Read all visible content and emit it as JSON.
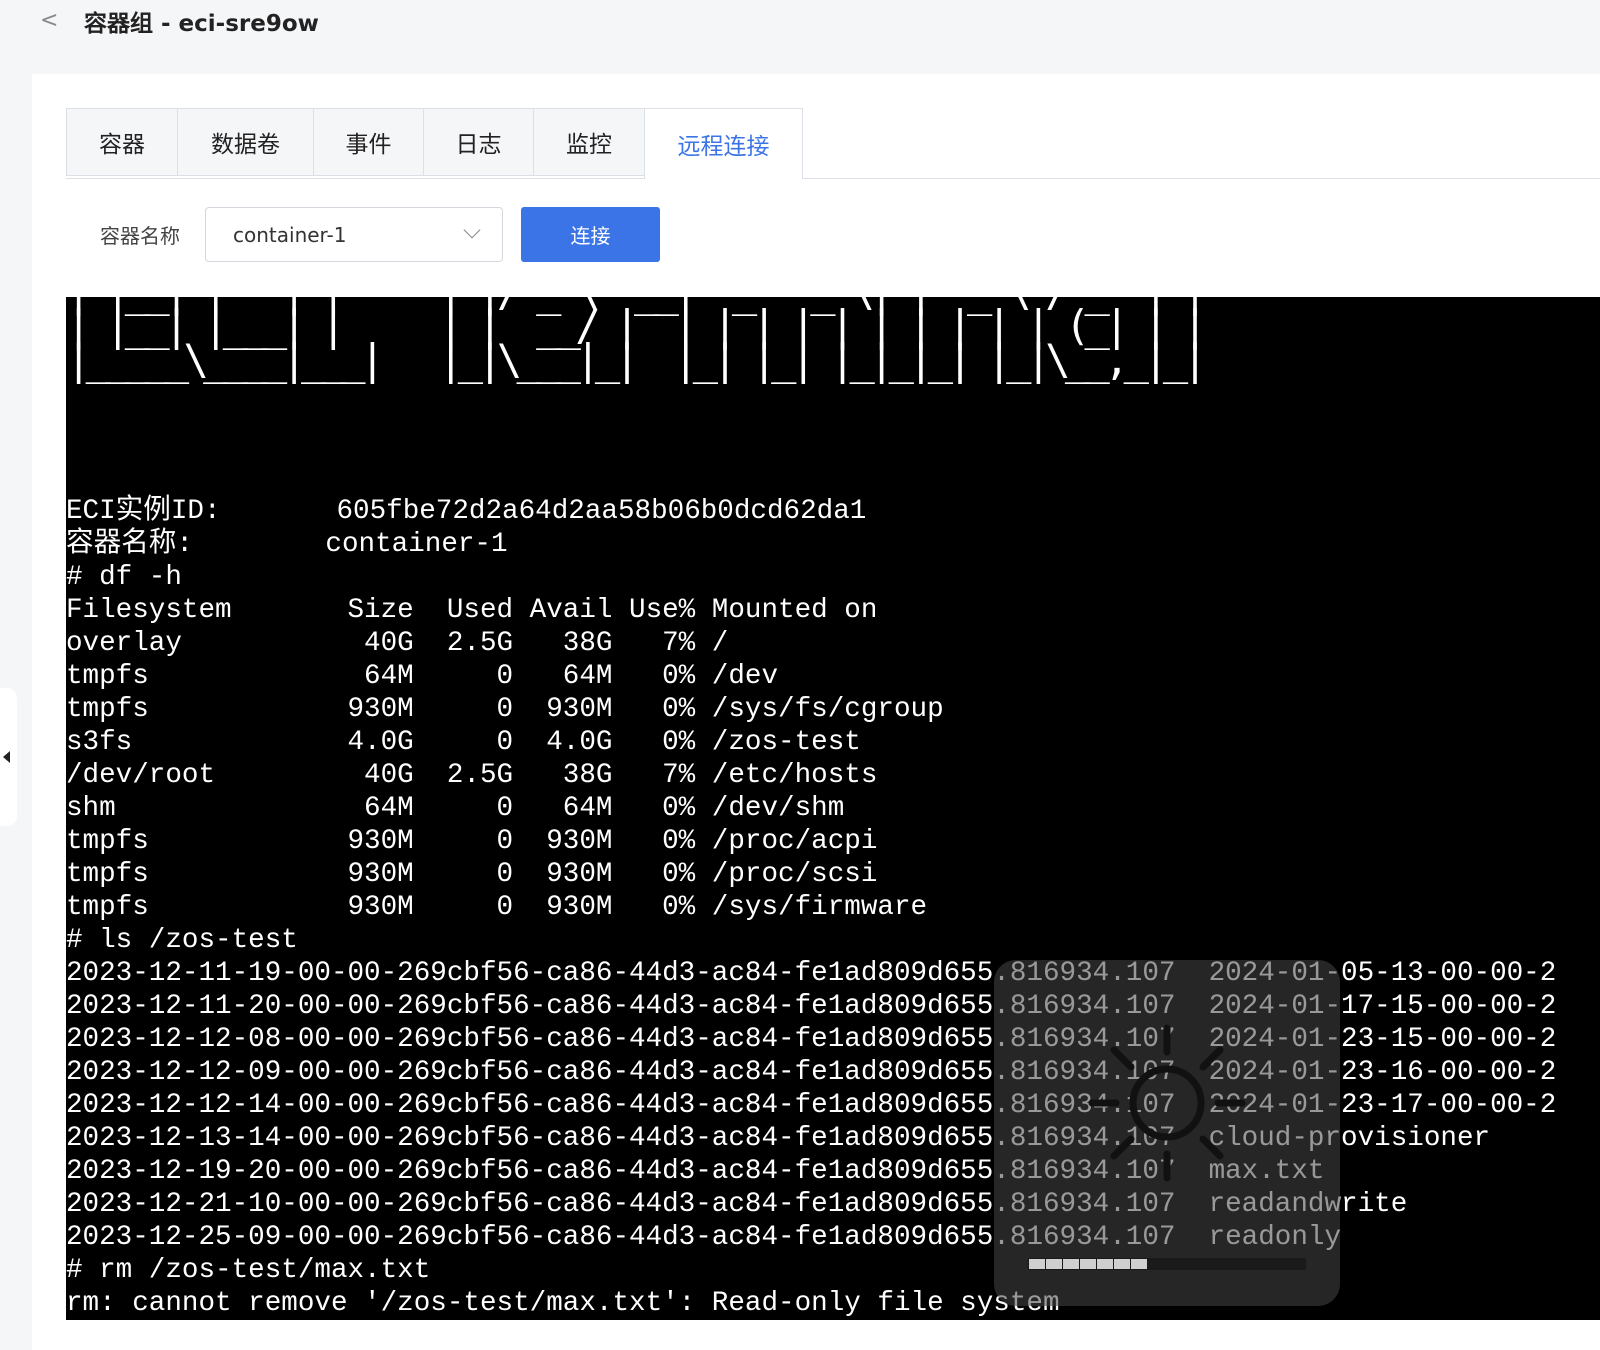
{
  "header": {
    "back_label": "<",
    "title": "容器组 - eci-sre9ow"
  },
  "tabs": [
    {
      "label": "容器",
      "active": false
    },
    {
      "label": "数据卷",
      "active": false
    },
    {
      "label": "事件",
      "active": false
    },
    {
      "label": "日志",
      "active": false
    },
    {
      "label": "监控",
      "active": false
    },
    {
      "label": "远程连接",
      "active": true
    }
  ],
  "connect_form": {
    "label": "容器名称",
    "selected_container": "container-1",
    "button_label": "连接"
  },
  "terminal": {
    "banner": [
      "| |__| |   | |     | |/ _ \\ '__| '_ ` _ \\| | '_ \\ / _` | |",
      "| |__| |___| |     | |  __/ |  | | | | | | | | | | (_| | |",
      "|_____\\____|___|   |_|\\___|_|  |_| |_| |_|_|_| |_|\\__,_|_|"
    ],
    "lines": [
      "ECI实例ID:       605fbe72d2a64d2aa58b06b0dcd62da1",
      "容器名称:        container-1",
      "# df -h",
      "Filesystem       Size  Used Avail Use% Mounted on",
      "overlay           40G  2.5G   38G   7% /",
      "tmpfs             64M     0   64M   0% /dev",
      "tmpfs            930M     0  930M   0% /sys/fs/cgroup",
      "s3fs             4.0G     0  4.0G   0% /zos-test",
      "/dev/root         40G  2.5G   38G   7% /etc/hosts",
      "shm               64M     0   64M   0% /dev/shm",
      "tmpfs            930M     0  930M   0% /proc/acpi",
      "tmpfs            930M     0  930M   0% /proc/scsi",
      "tmpfs            930M     0  930M   0% /sys/firmware",
      "# ls /zos-test",
      "2023-12-11-19-00-00-269cbf56-ca86-44d3-ac84-fe1ad809d655.816934.107  2024-01-05-13-00-00-2",
      "2023-12-11-20-00-00-269cbf56-ca86-44d3-ac84-fe1ad809d655.816934.107  2024-01-17-15-00-00-2",
      "2023-12-12-08-00-00-269cbf56-ca86-44d3-ac84-fe1ad809d655.816934.107  2024-01-23-15-00-00-2",
      "2023-12-12-09-00-00-269cbf56-ca86-44d3-ac84-fe1ad809d655.816934.107  2024-01-23-16-00-00-2",
      "2023-12-12-14-00-00-269cbf56-ca86-44d3-ac84-fe1ad809d655.816934.107  2024-01-23-17-00-00-2",
      "2023-12-13-14-00-00-269cbf56-ca86-44d3-ac84-fe1ad809d655.816934.107  cloud-provisioner",
      "2023-12-19-20-00-00-269cbf56-ca86-44d3-ac84-fe1ad809d655.816934.107  max.txt",
      "2023-12-21-10-00-00-269cbf56-ca86-44d3-ac84-fe1ad809d655.816934.107  readandwrite",
      "2023-12-25-09-00-00-269cbf56-ca86-44d3-ac84-fe1ad809d655.816934.107  readonly",
      "# rm /zos-test/max.txt",
      "rm: cannot remove '/zos-test/max.txt': Read-only file system"
    ]
  },
  "brightness_overlay": {
    "icon": "brightness-sun-icon",
    "level": 0.43
  },
  "side_panel": {
    "icon": "caret-left-icon"
  },
  "colors": {
    "accent": "#3b74e6",
    "terminal_bg": "#000000",
    "page_bg": "#f5f6f8"
  }
}
